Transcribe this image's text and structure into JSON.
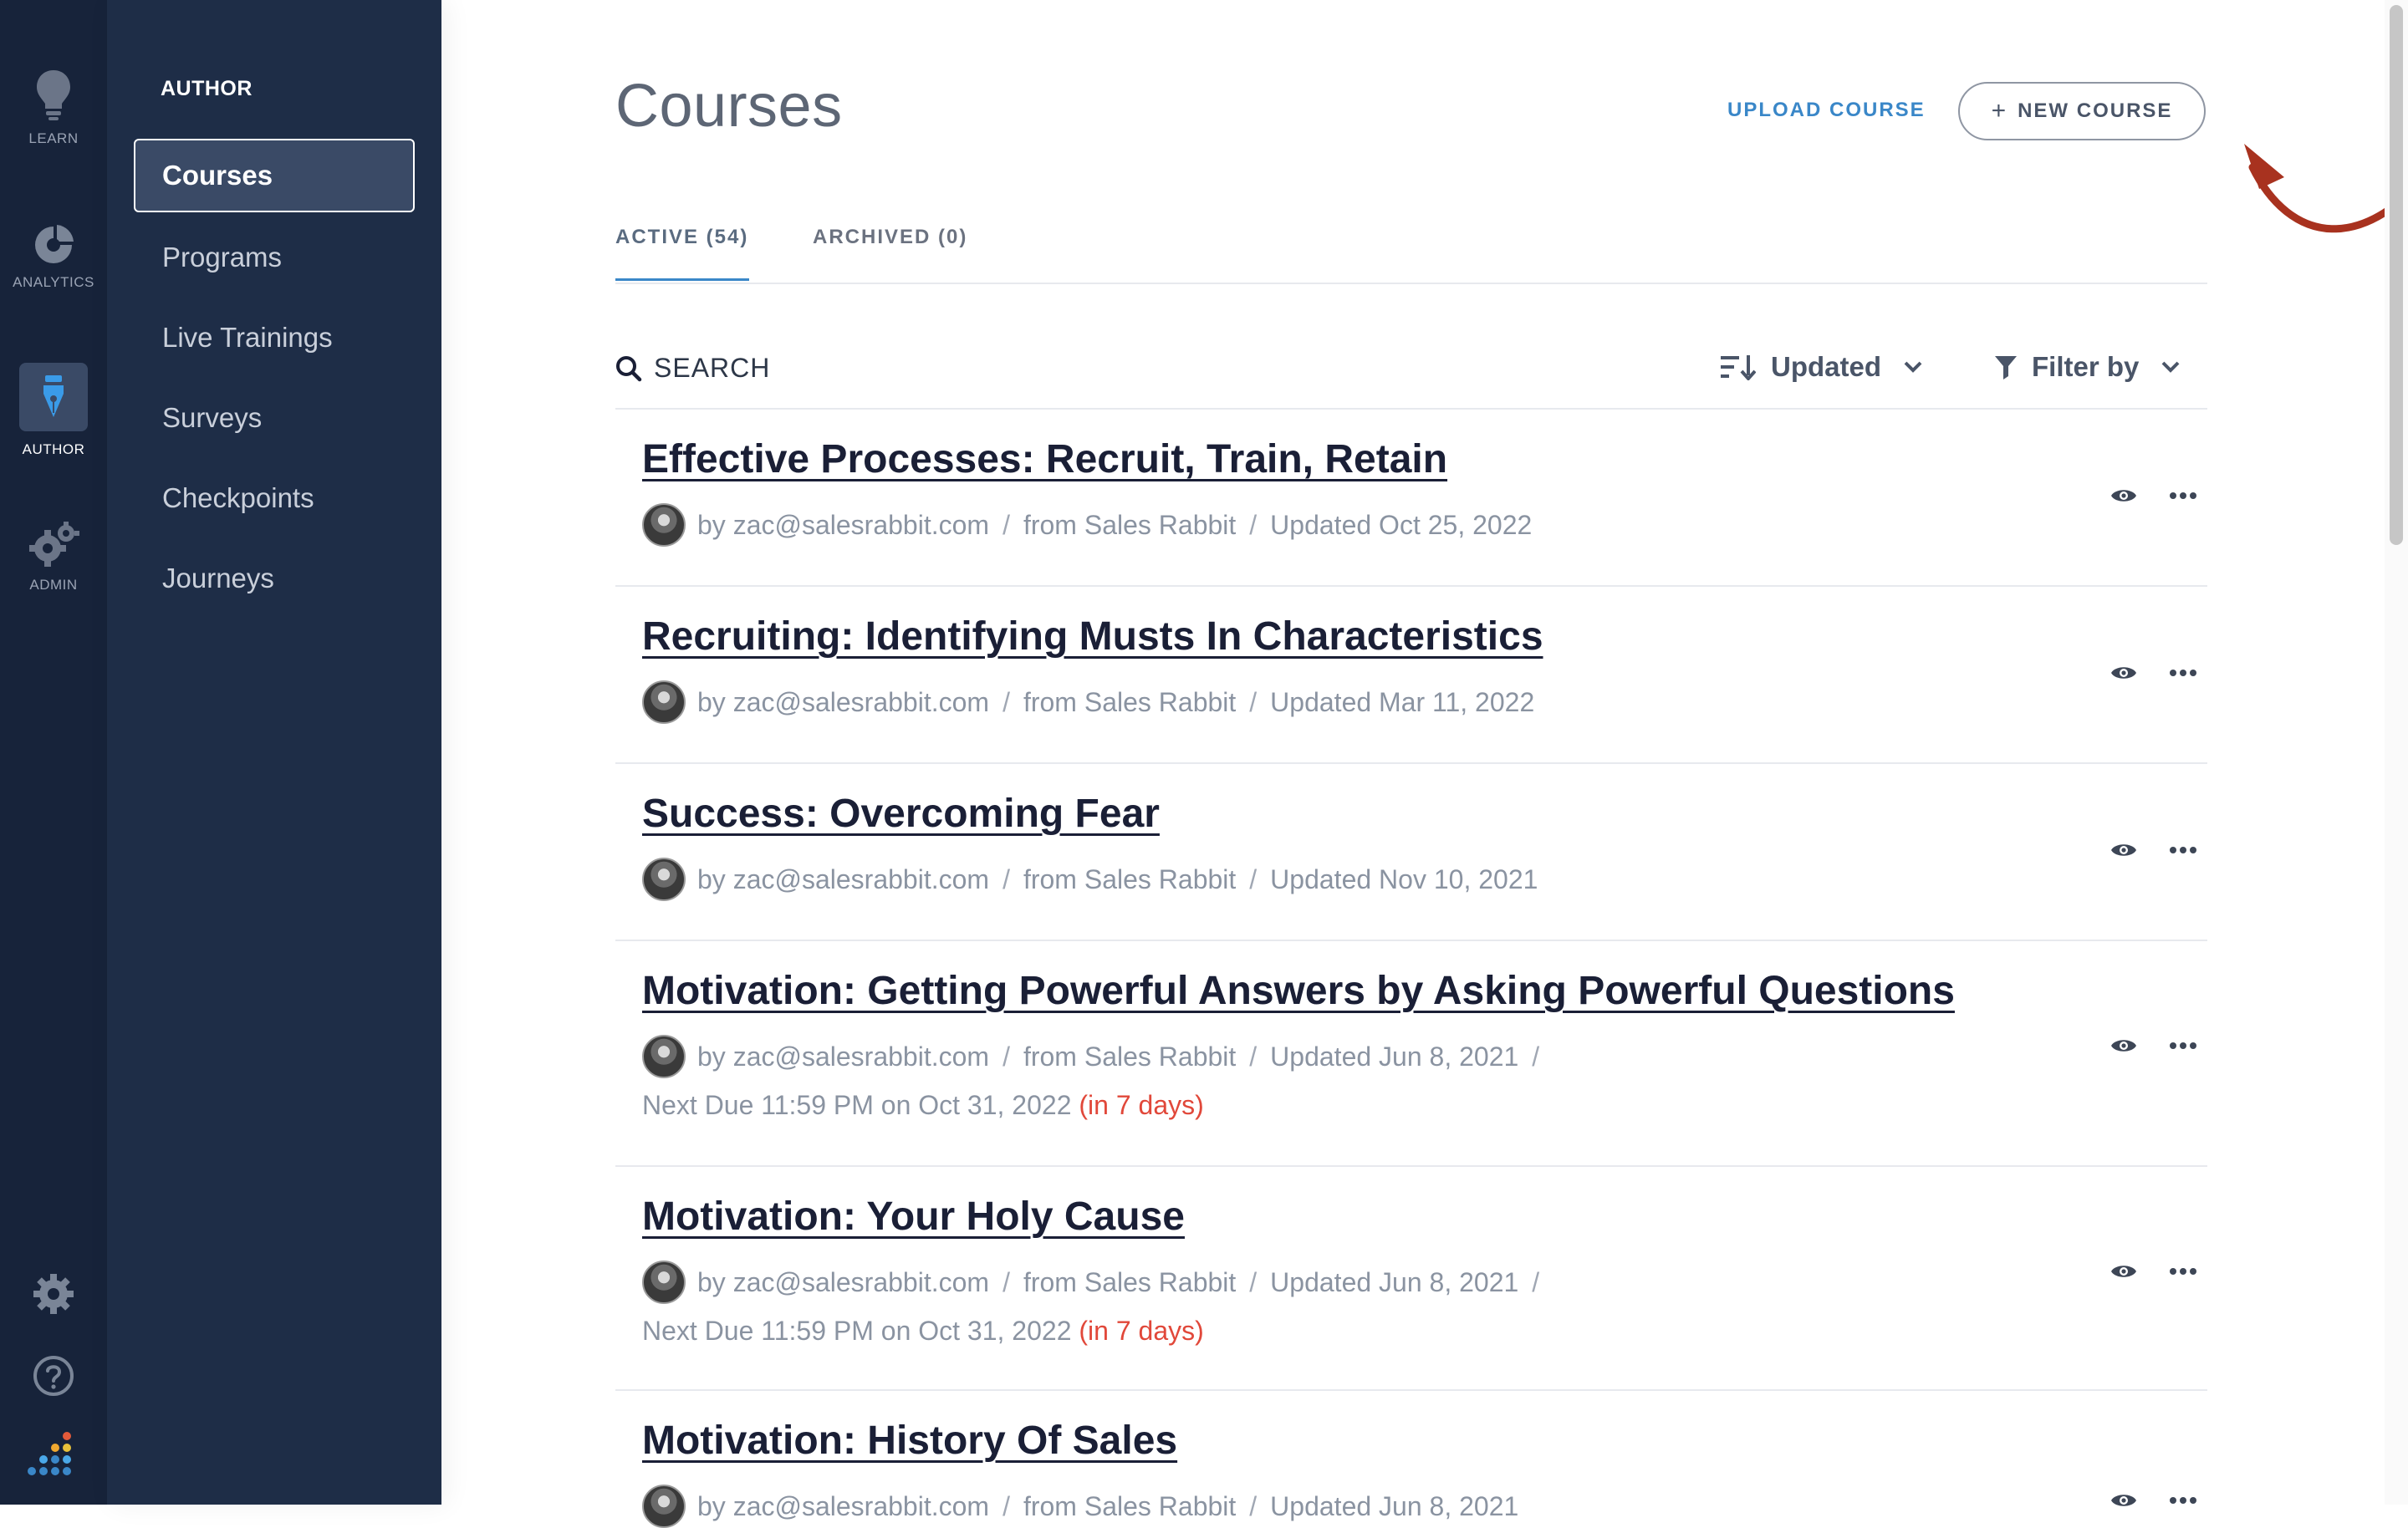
{
  "rail": {
    "items": [
      {
        "label": "LEARN",
        "icon": "lightbulb-icon"
      },
      {
        "label": "ANALYTICS",
        "icon": "pie-chart-icon"
      },
      {
        "label": "AUTHOR",
        "icon": "pen-nib-icon"
      },
      {
        "label": "ADMIN",
        "icon": "gears-icon"
      }
    ],
    "bottom_icons": [
      "settings-icon",
      "help-icon",
      "app-logo"
    ]
  },
  "subnav": {
    "title": "AUTHOR",
    "items": [
      {
        "label": "Courses",
        "active": true
      },
      {
        "label": "Programs"
      },
      {
        "label": "Live Trainings"
      },
      {
        "label": "Surveys"
      },
      {
        "label": "Checkpoints"
      },
      {
        "label": "Journeys"
      }
    ]
  },
  "header": {
    "title": "Courses",
    "upload_label": "UPLOAD COURSE",
    "new_plus": "+",
    "new_label": "NEW COURSE"
  },
  "tabs": [
    {
      "label": "ACTIVE (54)",
      "active": true
    },
    {
      "label": "ARCHIVED (0)"
    }
  ],
  "toolbar": {
    "search_label": "SEARCH",
    "sort_label": "Updated",
    "filter_label": "Filter by"
  },
  "courses": [
    {
      "title": "Effective Processes: Recruit, Train, Retain",
      "author": "by zac@salesrabbit.com",
      "org": "from Sales Rabbit",
      "updated": "Updated Oct 25, 2022"
    },
    {
      "title": "Recruiting: Identifying Musts In Characteristics",
      "author": "by zac@salesrabbit.com",
      "org": "from Sales Rabbit",
      "updated": "Updated Mar 11, 2022"
    },
    {
      "title": "Success: Overcoming Fear",
      "author": "by zac@salesrabbit.com",
      "org": "from Sales Rabbit",
      "updated": "Updated Nov 10, 2021"
    },
    {
      "title": "Motivation: Getting Powerful Answers by Asking Powerful Questions",
      "author": "by zac@salesrabbit.com",
      "org": "from Sales Rabbit",
      "updated": "Updated Jun 8, 2021",
      "due": "Next Due 11:59 PM on Oct 31, 2022",
      "due_rel": "(in 7 days)"
    },
    {
      "title": "Motivation: Your Holy Cause",
      "author": "by zac@salesrabbit.com",
      "org": "from Sales Rabbit",
      "updated": "Updated Jun 8, 2021",
      "due": "Next Due 11:59 PM on Oct 31, 2022",
      "due_rel": "(in 7 days)"
    },
    {
      "title": "Motivation: History Of Sales",
      "author": "by zac@salesrabbit.com",
      "org": "from Sales Rabbit",
      "updated": "Updated Jun 8, 2021"
    }
  ],
  "separator": "/",
  "colors": {
    "rail": "#17233a",
    "subnav": "#1e2d47",
    "accent": "#3a87c8",
    "due": "#e1483a",
    "annotation_arrow": "#a8321f"
  }
}
